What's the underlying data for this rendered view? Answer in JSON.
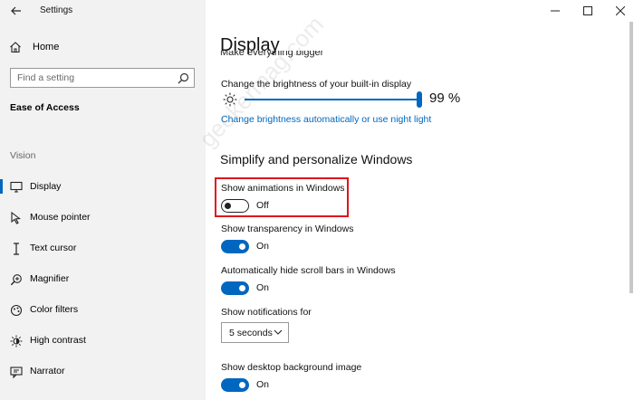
{
  "window": {
    "title": "Settings"
  },
  "sidebar": {
    "home_label": "Home",
    "search_placeholder": "Find a setting",
    "section_title": "Ease of Access",
    "group_label": "Vision",
    "items": [
      {
        "label": "Display",
        "icon": "monitor-icon",
        "active": true
      },
      {
        "label": "Mouse pointer",
        "icon": "mouse-pointer-icon"
      },
      {
        "label": "Text cursor",
        "icon": "text-cursor-icon"
      },
      {
        "label": "Magnifier",
        "icon": "magnifier-icon"
      },
      {
        "label": "Color filters",
        "icon": "color-filters-icon"
      },
      {
        "label": "High contrast",
        "icon": "high-contrast-icon"
      },
      {
        "label": "Narrator",
        "icon": "narrator-icon"
      }
    ]
  },
  "main": {
    "title": "Display",
    "clipped_text": "Make everything bigger",
    "brightness_label": "Change the brightness of your built-in display",
    "brightness_value": "99 %",
    "brightness_level": 0.99,
    "brightness_link": "Change brightness automatically or use night light",
    "section_title": "Simplify and personalize Windows",
    "animations": {
      "label": "Show animations in Windows",
      "state": "Off",
      "on": false
    },
    "transparency": {
      "label": "Show transparency in Windows",
      "state": "On",
      "on": true
    },
    "scrollbars": {
      "label": "Automatically hide scroll bars in Windows",
      "state": "On",
      "on": true
    },
    "notifications": {
      "label": "Show notifications for",
      "value": "5 seconds"
    },
    "background": {
      "label": "Show desktop background image",
      "state": "On",
      "on": true
    }
  },
  "watermark": "geekermag.com",
  "colors": {
    "accent": "#0067c0",
    "highlight": "#e0141e",
    "sidebar_bg": "#f2f2f2"
  }
}
